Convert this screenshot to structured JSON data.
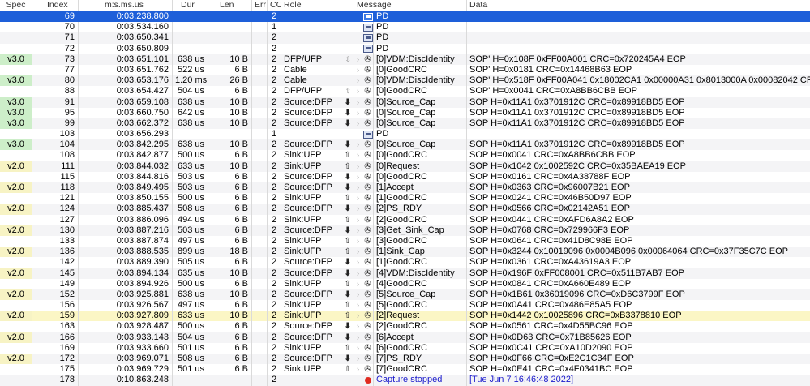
{
  "columns": {
    "spec": "Spec",
    "index": "Index",
    "time": "m:s.ms.us",
    "dur": "Dur",
    "len": "Len",
    "err": "Err",
    "cc": "CC",
    "role": "Role",
    "message": "Message",
    "data": "Data"
  },
  "rows": [
    {
      "spec": "",
      "index": "69",
      "time": "0:03.238.800",
      "dur": "",
      "len": "",
      "err": "",
      "cc": "2",
      "role": "",
      "arrow": "",
      "icon": "pd-icon",
      "msg": "PD",
      "data": "",
      "selected": true
    },
    {
      "spec": "",
      "index": "70",
      "time": "0:03.534.160",
      "dur": "",
      "len": "",
      "err": "",
      "cc": "1",
      "role": "",
      "arrow": "",
      "icon": "pd-icon",
      "msg": "PD",
      "data": ""
    },
    {
      "spec": "",
      "index": "71",
      "time": "0:03.650.341",
      "dur": "",
      "len": "",
      "err": "",
      "cc": "2",
      "role": "",
      "arrow": "",
      "icon": "pd-icon",
      "msg": "PD",
      "data": ""
    },
    {
      "spec": "",
      "index": "72",
      "time": "0:03.650.809",
      "dur": "",
      "len": "",
      "err": "",
      "cc": "2",
      "role": "",
      "arrow": "",
      "icon": "pd-icon",
      "msg": "PD",
      "data": ""
    },
    {
      "spec": "v3.0",
      "index": "73",
      "time": "0:03.651.101",
      "dur": "638 us",
      "len": "10 B",
      "err": "",
      "cc": "2",
      "role": "DFP/UFP",
      "arrow": "updown",
      "icon": "usb-icon",
      "msg": "[0]VDM:DiscIdentity",
      "data": "SOP' H=0x108F 0xFF00A001 CRC=0x720245A4 EOP"
    },
    {
      "spec": "",
      "index": "77",
      "time": "0:03.651.762",
      "dur": "522 us",
      "len": "6 B",
      "err": "",
      "cc": "2",
      "role": "Cable",
      "arrow": "",
      "icon": "usb-icon",
      "msg": "[0]GoodCRC",
      "data": "SOP' H=0x0181 CRC=0x14468B63 EOP"
    },
    {
      "spec": "v3.0",
      "index": "80",
      "time": "0:03.653.176",
      "dur": "1.20 ms",
      "len": "26 B",
      "err": "",
      "cc": "2",
      "role": "Cable",
      "arrow": "",
      "icon": "usb-icon",
      "msg": "[0]VDM:DiscIdentity",
      "data": "SOP' H=0x518F 0xFF00A041 0x18002CA1 0x00000A31 0x8013000A 0x00082042 CRC=0x206170BD EOP"
    },
    {
      "spec": "",
      "index": "88",
      "time": "0:03.654.427",
      "dur": "504 us",
      "len": "6 B",
      "err": "",
      "cc": "2",
      "role": "DFP/UFP",
      "arrow": "updown",
      "icon": "usb-icon",
      "msg": "[0]GoodCRC",
      "data": "SOP' H=0x0041 CRC=0xA8BB6CBB EOP"
    },
    {
      "spec": "v3.0",
      "index": "91",
      "time": "0:03.659.108",
      "dur": "638 us",
      "len": "10 B",
      "err": "",
      "cc": "2",
      "role": "Source:DFP",
      "arrow": "down",
      "icon": "usb-icon",
      "msg": "[0]Source_Cap",
      "data": "SOP H=0x11A1 0x3701912C CRC=0x89918BD5 EOP"
    },
    {
      "spec": "v3.0",
      "index": "95",
      "time": "0:03.660.750",
      "dur": "642 us",
      "len": "10 B",
      "err": "",
      "cc": "2",
      "role": "Source:DFP",
      "arrow": "down",
      "icon": "usb-icon",
      "msg": "[0]Source_Cap",
      "data": "SOP H=0x11A1 0x3701912C CRC=0x89918BD5 EOP"
    },
    {
      "spec": "v3.0",
      "index": "99",
      "time": "0:03.662.372",
      "dur": "638 us",
      "len": "10 B",
      "err": "",
      "cc": "2",
      "role": "Source:DFP",
      "arrow": "down",
      "icon": "usb-icon",
      "msg": "[0]Source_Cap",
      "data": "SOP H=0x11A1 0x3701912C CRC=0x89918BD5 EOP"
    },
    {
      "spec": "",
      "index": "103",
      "time": "0:03.656.293",
      "dur": "",
      "len": "",
      "err": "",
      "cc": "1",
      "role": "",
      "arrow": "",
      "icon": "pd-icon",
      "msg": "PD",
      "data": ""
    },
    {
      "spec": "v3.0",
      "index": "104",
      "time": "0:03.842.295",
      "dur": "638 us",
      "len": "10 B",
      "err": "",
      "cc": "2",
      "role": "Source:DFP",
      "arrow": "down",
      "icon": "usb-icon",
      "msg": "[0]Source_Cap",
      "data": "SOP H=0x11A1 0x3701912C CRC=0x89918BD5 EOP"
    },
    {
      "spec": "",
      "index": "108",
      "time": "0:03.842.877",
      "dur": "500 us",
      "len": "6 B",
      "err": "",
      "cc": "2",
      "role": "Sink:UFP",
      "arrow": "up",
      "icon": "usb-icon",
      "msg": "[0]GoodCRC",
      "data": "SOP H=0x0041 CRC=0xA8BB6CBB EOP"
    },
    {
      "spec": "v2.0",
      "index": "111",
      "time": "0:03.844.032",
      "dur": "633 us",
      "len": "10 B",
      "err": "",
      "cc": "2",
      "role": "Sink:UFP",
      "arrow": "up",
      "icon": "usb-icon",
      "msg": "[0]Request",
      "data": "SOP H=0x1042 0x1002592C CRC=0x35BAEA19 EOP"
    },
    {
      "spec": "",
      "index": "115",
      "time": "0:03.844.816",
      "dur": "503 us",
      "len": "6 B",
      "err": "",
      "cc": "2",
      "role": "Source:DFP",
      "arrow": "down",
      "icon": "usb-icon",
      "msg": "[0]GoodCRC",
      "data": "SOP H=0x0161 CRC=0x4A38788F EOP"
    },
    {
      "spec": "v2.0",
      "index": "118",
      "time": "0:03.849.495",
      "dur": "503 us",
      "len": "6 B",
      "err": "",
      "cc": "2",
      "role": "Source:DFP",
      "arrow": "down",
      "icon": "usb-icon",
      "msg": "[1]Accept",
      "data": "SOP H=0x0363 CRC=0x96007B21 EOP"
    },
    {
      "spec": "",
      "index": "121",
      "time": "0:03.850.155",
      "dur": "500 us",
      "len": "6 B",
      "err": "",
      "cc": "2",
      "role": "Sink:UFP",
      "arrow": "up",
      "icon": "usb-icon",
      "msg": "[1]GoodCRC",
      "data": "SOP H=0x0241 CRC=0x46B50D97 EOP"
    },
    {
      "spec": "v2.0",
      "index": "124",
      "time": "0:03.885.437",
      "dur": "508 us",
      "len": "6 B",
      "err": "",
      "cc": "2",
      "role": "Source:DFP",
      "arrow": "down",
      "icon": "usb-icon",
      "msg": "[2]PS_RDY",
      "data": "SOP H=0x0566 CRC=0x02142A51 EOP"
    },
    {
      "spec": "",
      "index": "127",
      "time": "0:03.886.096",
      "dur": "494 us",
      "len": "6 B",
      "err": "",
      "cc": "2",
      "role": "Sink:UFP",
      "arrow": "up",
      "icon": "usb-icon",
      "msg": "[2]GoodCRC",
      "data": "SOP H=0x0441 CRC=0xAFD6A8A2 EOP"
    },
    {
      "spec": "v2.0",
      "index": "130",
      "time": "0:03.887.216",
      "dur": "503 us",
      "len": "6 B",
      "err": "",
      "cc": "2",
      "role": "Source:DFP",
      "arrow": "down",
      "icon": "usb-icon",
      "msg": "[3]Get_Sink_Cap",
      "data": "SOP H=0x0768 CRC=0x729966F3 EOP"
    },
    {
      "spec": "",
      "index": "133",
      "time": "0:03.887.874",
      "dur": "497 us",
      "len": "6 B",
      "err": "",
      "cc": "2",
      "role": "Sink:UFP",
      "arrow": "up",
      "icon": "usb-icon",
      "msg": "[3]GoodCRC",
      "data": "SOP H=0x0641 CRC=0x41D8C98E EOP"
    },
    {
      "spec": "v2.0",
      "index": "136",
      "time": "0:03.888.535",
      "dur": "899 us",
      "len": "18 B",
      "err": "",
      "cc": "2",
      "role": "Sink:UFP",
      "arrow": "up",
      "icon": "usb-icon",
      "msg": "[1]Sink_Cap",
      "data": "SOP H=0x3244 0x10019096 0x0004B096 0x00064064 CRC=0x37F35C7C EOP"
    },
    {
      "spec": "",
      "index": "142",
      "time": "0:03.889.390",
      "dur": "505 us",
      "len": "6 B",
      "err": "",
      "cc": "2",
      "role": "Source:DFP",
      "arrow": "down",
      "icon": "usb-icon",
      "msg": "[1]GoodCRC",
      "data": "SOP H=0x0361 CRC=0xA43619A3 EOP"
    },
    {
      "spec": "v2.0",
      "index": "145",
      "time": "0:03.894.134",
      "dur": "635 us",
      "len": "10 B",
      "err": "",
      "cc": "2",
      "role": "Source:DFP",
      "arrow": "down",
      "icon": "usb-icon",
      "msg": "[4]VDM:DiscIdentity",
      "data": "SOP H=0x196F 0xFF008001 CRC=0x511B7AB7 EOP"
    },
    {
      "spec": "",
      "index": "149",
      "time": "0:03.894.926",
      "dur": "500 us",
      "len": "6 B",
      "err": "",
      "cc": "2",
      "role": "Sink:UFP",
      "arrow": "up",
      "icon": "usb-icon",
      "msg": "[4]GoodCRC",
      "data": "SOP H=0x0841 CRC=0xA660E489 EOP"
    },
    {
      "spec": "v2.0",
      "index": "152",
      "time": "0:03.925.881",
      "dur": "638 us",
      "len": "10 B",
      "err": "",
      "cc": "2",
      "role": "Source:DFP",
      "arrow": "down",
      "icon": "usb-icon",
      "msg": "[5]Source_Cap",
      "data": "SOP H=0x1B61 0x36019096 CRC=0xD6C3799F EOP"
    },
    {
      "spec": "",
      "index": "156",
      "time": "0:03.926.567",
      "dur": "497 us",
      "len": "6 B",
      "err": "",
      "cc": "2",
      "role": "Sink:UFP",
      "arrow": "up",
      "icon": "usb-icon",
      "msg": "[5]GoodCRC",
      "data": "SOP H=0x0A41 CRC=0x486E85A5 EOP"
    },
    {
      "spec": "v2.0",
      "index": "159",
      "time": "0:03.927.809",
      "dur": "633 us",
      "len": "10 B",
      "err": "",
      "cc": "2",
      "role": "Sink:UFP",
      "arrow": "up",
      "icon": "usb-icon",
      "msg": "[2]Request",
      "data": "SOP H=0x1442 0x10025896 CRC=0xB3378810 EOP",
      "highlight": true
    },
    {
      "spec": "",
      "index": "163",
      "time": "0:03.928.487",
      "dur": "500 us",
      "len": "6 B",
      "err": "",
      "cc": "2",
      "role": "Source:DFP",
      "arrow": "down",
      "icon": "usb-icon",
      "msg": "[2]GoodCRC",
      "data": "SOP H=0x0561 CRC=0x4D55BC96 EOP"
    },
    {
      "spec": "v2.0",
      "index": "166",
      "time": "0:03.933.143",
      "dur": "504 us",
      "len": "6 B",
      "err": "",
      "cc": "2",
      "role": "Source:DFP",
      "arrow": "down",
      "icon": "usb-icon",
      "msg": "[6]Accept",
      "data": "SOP H=0x0D63 CRC=0x71B85626 EOP"
    },
    {
      "spec": "",
      "index": "169",
      "time": "0:03.933.660",
      "dur": "501 us",
      "len": "6 B",
      "err": "",
      "cc": "2",
      "role": "Sink:UFP",
      "arrow": "up",
      "icon": "usb-icon",
      "msg": "[6]GoodCRC",
      "data": "SOP H=0x0C41 CRC=0xA10D2090 EOP"
    },
    {
      "spec": "v2.0",
      "index": "172",
      "time": "0:03.969.071",
      "dur": "508 us",
      "len": "6 B",
      "err": "",
      "cc": "2",
      "role": "Source:DFP",
      "arrow": "down",
      "icon": "usb-icon",
      "msg": "[7]PS_RDY",
      "data": "SOP H=0x0F66 CRC=0xE2C1C34F EOP"
    },
    {
      "spec": "",
      "index": "175",
      "time": "0:03.969.729",
      "dur": "501 us",
      "len": "6 B",
      "err": "",
      "cc": "2",
      "role": "Sink:UFP",
      "arrow": "up",
      "icon": "usb-icon",
      "msg": "[7]GoodCRC",
      "data": "SOP H=0x0E41 CRC=0x4F0341BC EOP"
    },
    {
      "spec": "",
      "index": "178",
      "time": "0:10.863.248",
      "dur": "",
      "len": "",
      "err": "",
      "cc": "2",
      "role": "",
      "arrow": "",
      "icon": "stop-icon",
      "msg": "Capture stopped",
      "data": "[Tue Jun  7 16:46:48 2022]",
      "capture": true
    }
  ]
}
